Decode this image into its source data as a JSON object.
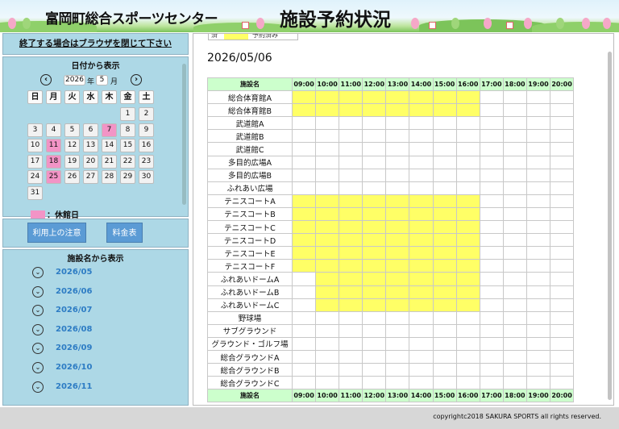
{
  "header": {
    "site_title": "富岡町総合スポーツセンター",
    "page_title": "施設予約状況"
  },
  "exit_notice": "終了する場合はブラウザを閉じて下さい",
  "calendar": {
    "heading": "日付から表示",
    "year": "2026",
    "year_label": "年",
    "month": "5",
    "month_label": "月",
    "prev_icon": "arrow-left-icon",
    "next_icon": "arrow-right-icon",
    "weekdays": [
      "日",
      "月",
      "火",
      "水",
      "木",
      "金",
      "土"
    ],
    "weeks": [
      [
        "",
        "",
        "",
        "",
        "",
        "1",
        "2"
      ],
      [
        "3",
        "4",
        "5",
        "6",
        "7",
        "8",
        "9"
      ],
      [
        "10",
        "11",
        "12",
        "13",
        "14",
        "15",
        "16"
      ],
      [
        "17",
        "18",
        "19",
        "20",
        "21",
        "22",
        "23"
      ],
      [
        "24",
        "25",
        "26",
        "27",
        "28",
        "29",
        "30"
      ],
      [
        "31",
        "",
        "",
        "",
        "",
        "",
        ""
      ]
    ],
    "closed_days": [
      "7",
      "11",
      "18",
      "25"
    ],
    "closed_color": "#f294c6",
    "legend_label": "：休館日"
  },
  "buttons": {
    "notes": "利用上の注意",
    "fees": "料金表"
  },
  "facility_nav": {
    "heading": "施設名から表示",
    "icon": "chevron-down-circle-icon",
    "months": [
      "2026/05",
      "2026/06",
      "2026/07",
      "2026/08",
      "2026/09",
      "2026/10",
      "2026/11"
    ]
  },
  "schedule": {
    "legend_left": "済",
    "legend_right": "予約済み",
    "booked_color": "#ffff66",
    "header_color": "#ccffcc",
    "date": "2026/05/06",
    "facility_header": "施設名",
    "times": [
      "09:00",
      "10:00",
      "11:00",
      "12:00",
      "13:00",
      "14:00",
      "15:00",
      "16:00",
      "17:00",
      "18:00",
      "19:00",
      "20:00"
    ],
    "rows": [
      {
        "name": "総合体育館A",
        "booked": [
          0,
          1,
          2,
          3,
          4,
          5,
          6,
          7
        ]
      },
      {
        "name": "総合体育館B",
        "booked": [
          0,
          1,
          2,
          3,
          4,
          5,
          6,
          7
        ]
      },
      {
        "name": "武道館A",
        "booked": []
      },
      {
        "name": "武道館B",
        "booked": []
      },
      {
        "name": "武道館C",
        "booked": []
      },
      {
        "name": "多目的広場A",
        "booked": []
      },
      {
        "name": "多目的広場B",
        "booked": []
      },
      {
        "name": "ふれあい広場",
        "booked": []
      },
      {
        "name": "テニスコートA",
        "booked": [
          0,
          1,
          2,
          3,
          4,
          5,
          6,
          7
        ]
      },
      {
        "name": "テニスコートB",
        "booked": [
          0,
          1,
          2,
          3,
          4,
          5,
          6,
          7
        ]
      },
      {
        "name": "テニスコートC",
        "booked": [
          0,
          1,
          2,
          3,
          4,
          5,
          6,
          7
        ]
      },
      {
        "name": "テニスコートD",
        "booked": [
          0,
          1,
          2,
          3,
          4,
          5,
          6,
          7
        ]
      },
      {
        "name": "テニスコートE",
        "booked": [
          0,
          1,
          2,
          3,
          4,
          5,
          6,
          7
        ]
      },
      {
        "name": "テニスコートF",
        "booked": [
          0,
          1,
          2,
          3,
          4,
          5,
          6,
          7
        ]
      },
      {
        "name": "ふれあいドームA",
        "booked": [
          1,
          2,
          3,
          4,
          5,
          6,
          7
        ]
      },
      {
        "name": "ふれあいドームB",
        "booked": [
          1,
          2,
          3,
          4,
          5,
          6,
          7
        ]
      },
      {
        "name": "ふれあいドームC",
        "booked": [
          1,
          2,
          3,
          4,
          5,
          6,
          7
        ]
      },
      {
        "name": "野球場",
        "booked": []
      },
      {
        "name": "サブグラウンド",
        "booked": []
      },
      {
        "name": "グラウンド・ゴルフ場",
        "booked": []
      },
      {
        "name": "総合グラウンドA",
        "booked": []
      },
      {
        "name": "総合グラウンドB",
        "booked": []
      },
      {
        "name": "総合グラウンドC",
        "booked": []
      }
    ]
  },
  "footer": {
    "copyright": "copyrightc2018 SAKURA SPORTS all rights reserved."
  }
}
